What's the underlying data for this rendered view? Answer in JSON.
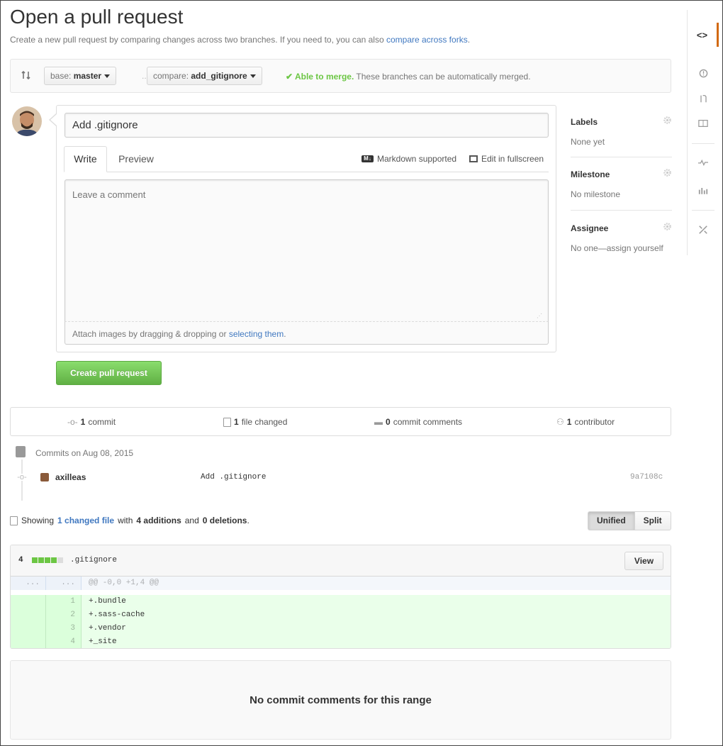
{
  "header": {
    "title": "Open a pull request",
    "subtitle_prefix": "Create a new pull request by comparing changes across two branches. If you need to, you can also ",
    "subtitle_link": "compare across forks",
    "subtitle_suffix": "."
  },
  "range": {
    "base_label": "base: ",
    "base_branch": "master",
    "separator": "...",
    "compare_label": "compare: ",
    "compare_branch": "add_gitignore",
    "merge_check": "✔ Able to merge.",
    "merge_text": " These branches can be automatically merged."
  },
  "form": {
    "title_value": "Add .gitignore",
    "tabs": [
      "Write",
      "Preview"
    ],
    "markdown_icon": "M↓",
    "markdown_label": "Markdown supported",
    "fullscreen_label": "Edit in fullscreen",
    "comment_placeholder": "Leave a comment",
    "attach_prefix": "Attach images by dragging & dropping or ",
    "attach_link": "selecting them",
    "attach_suffix": ".",
    "submit_label": "Create pull request"
  },
  "sidebar": {
    "labels": {
      "heading": "Labels",
      "value": "None yet"
    },
    "milestone": {
      "heading": "Milestone",
      "value": "No milestone"
    },
    "assignee": {
      "heading": "Assignee",
      "value": "No one—assign yourself"
    }
  },
  "repo_nav": [
    "code-icon",
    "issues-icon",
    "pull-requests-icon",
    "wiki-icon",
    "pulse-icon",
    "graphs-icon",
    "settings-icon"
  ],
  "numbers": {
    "commits": {
      "count": "1",
      "label": " commit"
    },
    "files": {
      "count": "1",
      "label": " file changed"
    },
    "comments": {
      "count": "0",
      "label": " commit comments"
    },
    "contributors": {
      "count": "1",
      "label": " contributor"
    }
  },
  "commits": {
    "date_label": "Commits on Aug 08, 2015",
    "items": [
      {
        "author": "axilleas",
        "message": "Add .gitignore",
        "sha": "9a7108c"
      }
    ]
  },
  "diff": {
    "showing": "Showing",
    "changed_link": "1 changed file",
    "with": "with",
    "additions": "4 additions",
    "and": "and",
    "deletions": "0 deletions",
    "period": ".",
    "view_unified": "Unified",
    "view_split": "Split",
    "colors": {
      "added": "#6cc644",
      "neutral": "#dddddd"
    },
    "file": {
      "stat": "4",
      "name": ".gitignore",
      "view_label": "View",
      "hunk": {
        "n1": "...",
        "n2": "...",
        "code": "@@ -0,0 +1,4 @@"
      },
      "lines": [
        {
          "n1": "",
          "n2": "1",
          "code": "+.bundle"
        },
        {
          "n1": "",
          "n2": "2",
          "code": "+.sass-cache"
        },
        {
          "n1": "",
          "n2": "3",
          "code": "+.vendor"
        },
        {
          "n1": "",
          "n2": "4",
          "code": "+_site"
        }
      ]
    }
  },
  "no_comments": "No commit comments for this range"
}
